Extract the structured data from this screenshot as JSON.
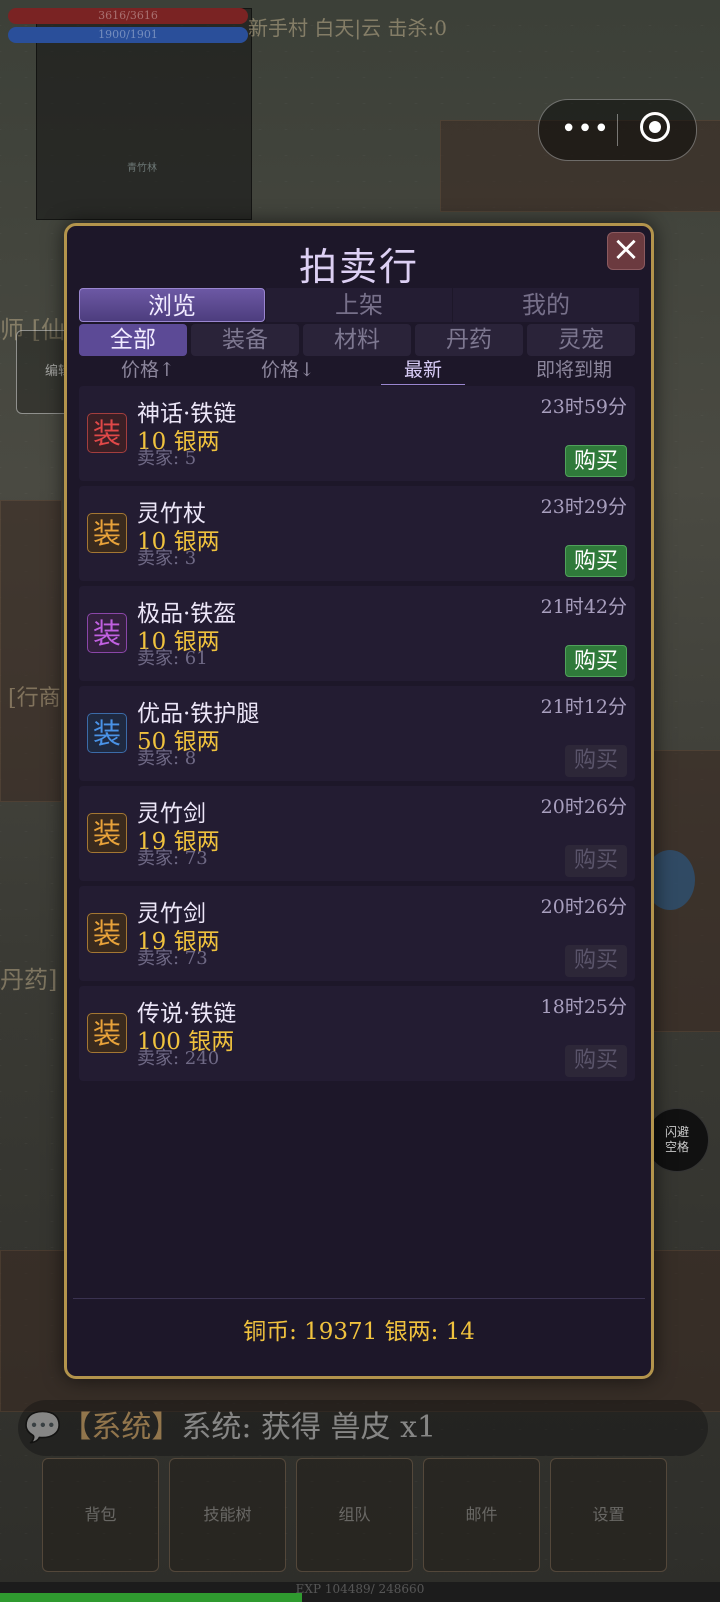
{
  "hud": {
    "hp_text": "3616/3616",
    "mp_text": "1900/1901",
    "minimap_label": "青竹林",
    "status": "新手村  白天|云  击杀:0",
    "left_tag_1": "师 [仙",
    "left_tag_2": "[行商",
    "left_tag_3": "丹药]",
    "edit_label": "编辑",
    "dodge_label_1": "闪避",
    "dodge_label_2": "空格"
  },
  "capsule": {
    "more": "•••"
  },
  "auction": {
    "title": "拍卖行",
    "close": "×",
    "tabs": [
      {
        "label": "浏览",
        "active": true
      },
      {
        "label": "上架",
        "active": false
      },
      {
        "label": "我的",
        "active": false
      }
    ],
    "categories": [
      {
        "label": "全部",
        "active": true
      },
      {
        "label": "装备",
        "active": false
      },
      {
        "label": "材料",
        "active": false
      },
      {
        "label": "丹药",
        "active": false
      },
      {
        "label": "灵宠",
        "active": false
      }
    ],
    "sorts": [
      {
        "label": "价格↑",
        "active": false
      },
      {
        "label": "价格↓",
        "active": false
      },
      {
        "label": "最新",
        "active": true
      },
      {
        "label": "即将到期",
        "active": false
      }
    ],
    "items": [
      {
        "badge": "装",
        "badge_color": "red",
        "name": "神话·铁链",
        "price": "10 银两",
        "seller": "卖家: 5",
        "time": "23时59分",
        "buy": "购买",
        "buy_enabled": true
      },
      {
        "badge": "装",
        "badge_color": "gold",
        "name": "灵竹杖",
        "price": "10 银两",
        "seller": "卖家: 3",
        "time": "23时29分",
        "buy": "购买",
        "buy_enabled": true
      },
      {
        "badge": "装",
        "badge_color": "purple",
        "name": "极品·铁盔",
        "price": "10 银两",
        "seller": "卖家: 61",
        "time": "21时42分",
        "buy": "购买",
        "buy_enabled": true
      },
      {
        "badge": "装",
        "badge_color": "blue",
        "name": "优品·铁护腿",
        "price": "50 银两",
        "seller": "卖家: 8",
        "time": "21时12分",
        "buy": "购买",
        "buy_enabled": false
      },
      {
        "badge": "装",
        "badge_color": "gold",
        "name": "灵竹剑",
        "price": "19 银两",
        "seller": "卖家: 73",
        "time": "20时26分",
        "buy": "购买",
        "buy_enabled": false
      },
      {
        "badge": "装",
        "badge_color": "gold",
        "name": "灵竹剑",
        "price": "19 银两",
        "seller": "卖家: 73",
        "time": "20时26分",
        "buy": "购买",
        "buy_enabled": false
      },
      {
        "badge": "装",
        "badge_color": "gold",
        "name": "传说·铁链",
        "price": "100 银两",
        "seller": "卖家: 240",
        "time": "18时25分",
        "buy": "购买",
        "buy_enabled": false
      }
    ],
    "currency": "铜币: 19371  银两: 14"
  },
  "chat": {
    "tag": "【系统】",
    "text": "系统: 获得 兽皮 x1"
  },
  "bottom": {
    "buttons": [
      "背包",
      "技能树",
      "组队",
      "邮件",
      "设置"
    ]
  },
  "exp": {
    "text": "EXP 104489/ 248660",
    "fraction": 0.42
  },
  "colors": {
    "panel_border": "#b3944c",
    "accent": "#6c58a4",
    "buy_green": "#2f7a3a",
    "price_gold": "#f0c23e"
  }
}
